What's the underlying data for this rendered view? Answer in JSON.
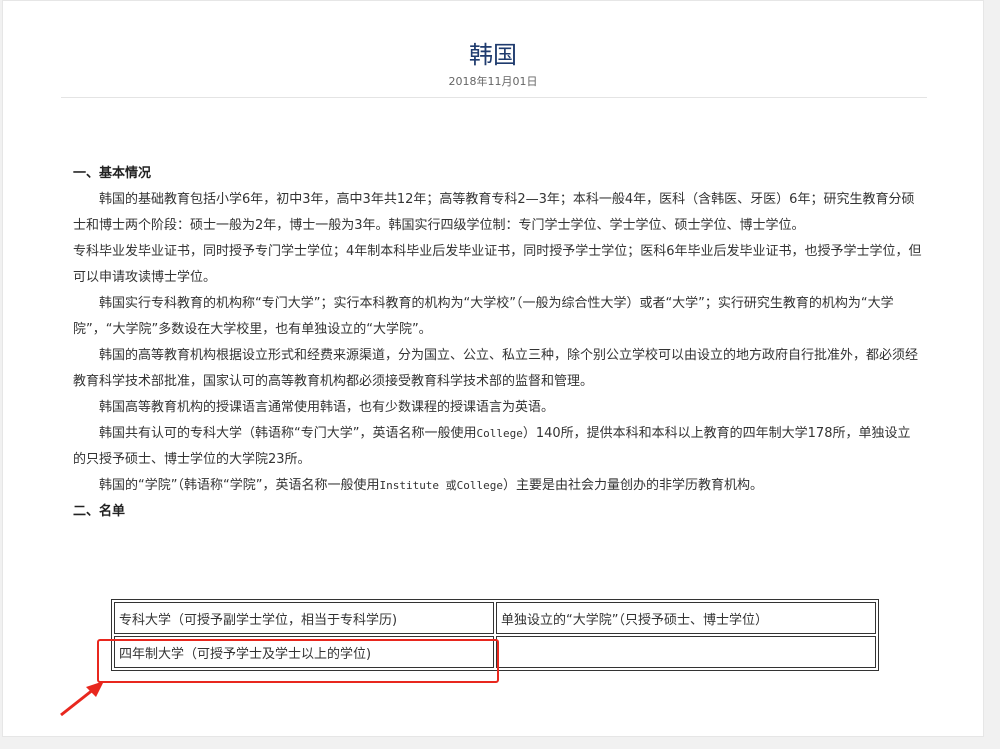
{
  "article": {
    "title": "韩国",
    "date": "2018年11月01日"
  },
  "sections": {
    "s1_heading": "一、基本情况",
    "p1": "韩国的基础教育包括小学6年，初中3年，高中3年共12年；高等教育专科2—3年；本科一般4年，医科（含韩医、牙医）6年；研究生教育分硕士和博士两个阶段：硕士一般为2年，博士一般为3年。韩国实行四级学位制：专门学士学位、学士学位、硕士学位、博士学位。",
    "p2": "专科毕业发毕业证书，同时授予专门学士学位；4年制本科毕业后发毕业证书，同时授予学士学位；医科6年毕业后发毕业证书，也授予学士学位，但可以申请攻读博士学位。",
    "p3": "韩国实行专科教育的机构称“专门大学”；实行本科教育的机构为“大学校”（一般为综合性大学）或者“大学”；实行研究生教育的机构为“大学院”，“大学院”多数设在大学校里，也有单独设立的“大学院”。",
    "p4": "韩国的高等教育机构根据设立形式和经费来源渠道，分为国立、公立、私立三种，除个别公立学校可以由设立的地方政府自行批准外，都必须经教育科学技术部批准，国家认可的高等教育机构都必须接受教育科学技术部的监督和管理。",
    "p5": "韩国高等教育机构的授课语言通常使用韩语，也有少数课程的授课语言为英语。",
    "p6a": "韩国共有认可的专科大学（韩语称“专门大学”，英语名称一般使用",
    "p6b": "College",
    "p6c": "）140所，提供本科和本科以上教育的四年制大学178所，单独设立的只授予硕士、博士学位的大学院23所。",
    "p7a": "韩国的“学院”（韩语称“学院”，英语名称一般使用",
    "p7b": "Institute 或College",
    "p7c": "）主要是由社会力量创办的非学历教育机构。",
    "s2_heading": "二、名单"
  },
  "list_table": {
    "r1c1": "专科大学（可授予副学士学位，相当于专科学历)",
    "r1c2": "单独设立的“大学院”（只授予硕士、博士学位）",
    "r2c1": "四年制大学（可授予学士及学士以上的学位)",
    "r2c2": ""
  },
  "annotation": {
    "color": "#e8271e",
    "icon": "red-arrow-pointer"
  }
}
